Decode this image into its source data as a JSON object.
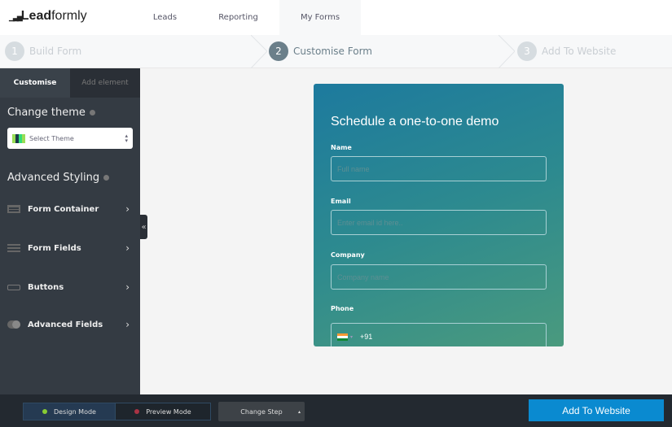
{
  "brand": {
    "logo_bold": "Lead",
    "logo_light": "formly"
  },
  "nav": [
    "Leads",
    "Reporting",
    "My Forms"
  ],
  "steps": [
    {
      "num": "1",
      "label": "Build Form"
    },
    {
      "num": "2",
      "label": "Customise Form"
    },
    {
      "num": "3",
      "label": "Add To Website"
    }
  ],
  "sidebar": {
    "tabs": [
      "Customise",
      "Add element"
    ],
    "change_theme": "Change theme",
    "theme_select": "Select Theme",
    "advanced_styling": "Advanced Styling",
    "items": [
      "Form Container",
      "Form Fields",
      "Buttons",
      "Advanced Fields"
    ]
  },
  "form": {
    "title": "Schedule a one-to-one demo",
    "fields": [
      {
        "label": "Name",
        "placeholder": "Full name"
      },
      {
        "label": "Email",
        "placeholder": "Enter email id here.."
      },
      {
        "label": "Company",
        "placeholder": "Company name"
      },
      {
        "label": "Phone",
        "value": "+91"
      }
    ]
  },
  "bottom": {
    "design_mode": "Design Mode",
    "preview_mode": "Preview Mode",
    "change_step": "Change Step",
    "add_to_website": "Add To Website"
  }
}
